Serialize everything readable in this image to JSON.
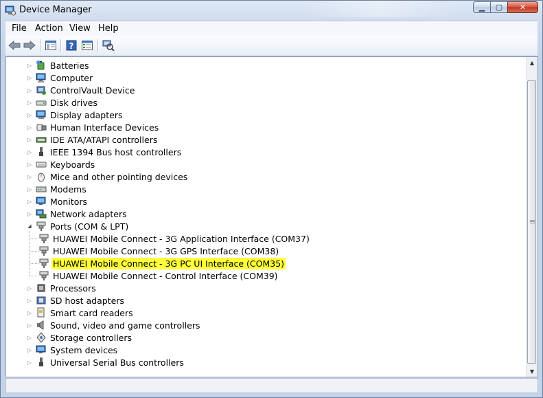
{
  "window": {
    "title": "Device Manager"
  },
  "menu": [
    "File",
    "Action",
    "View",
    "Help"
  ],
  "toolbar": {
    "buttons": [
      "back-arrow-icon",
      "forward-arrow-icon",
      "show-hide-console-tree-icon",
      "help-icon",
      "properties-icon",
      "scan-hardware-changes-icon"
    ]
  },
  "tree": {
    "categories": [
      {
        "label": "Batteries",
        "icon": "battery-icon",
        "expanded": false
      },
      {
        "label": "Computer",
        "icon": "computer-icon",
        "expanded": false
      },
      {
        "label": "ControlVault Device",
        "icon": "controlvault-icon",
        "expanded": false
      },
      {
        "label": "Disk drives",
        "icon": "disk-drive-icon",
        "expanded": false
      },
      {
        "label": "Display adapters",
        "icon": "display-adapter-icon",
        "expanded": false
      },
      {
        "label": "Human Interface Devices",
        "icon": "hid-icon",
        "expanded": false
      },
      {
        "label": "IDE ATA/ATAPI controllers",
        "icon": "ide-controller-icon",
        "expanded": false
      },
      {
        "label": "IEEE 1394 Bus host controllers",
        "icon": "ieee1394-icon",
        "expanded": false
      },
      {
        "label": "Keyboards",
        "icon": "keyboard-icon",
        "expanded": false
      },
      {
        "label": "Mice and other pointing devices",
        "icon": "mouse-icon",
        "expanded": false
      },
      {
        "label": "Modems",
        "icon": "modem-icon",
        "expanded": false
      },
      {
        "label": "Monitors",
        "icon": "monitor-icon",
        "expanded": false
      },
      {
        "label": "Network adapters",
        "icon": "network-adapter-icon",
        "expanded": false
      },
      {
        "label": "Ports (COM & LPT)",
        "icon": "port-icon",
        "expanded": true,
        "children": [
          {
            "label": "HUAWEI Mobile Connect - 3G Application Interface (COM37)",
            "icon": "port-icon",
            "highlighted": false
          },
          {
            "label": "HUAWEI Mobile Connect - 3G GPS Interface (COM38)",
            "icon": "port-icon",
            "highlighted": false
          },
          {
            "label": "HUAWEI Mobile Connect - 3G PC UI Interface (COM35)",
            "icon": "port-icon",
            "highlighted": true
          },
          {
            "label": "HUAWEI Mobile Connect - Control Interface (COM39)",
            "icon": "port-icon",
            "highlighted": false
          }
        ]
      },
      {
        "label": "Processors",
        "icon": "processor-icon",
        "expanded": false
      },
      {
        "label": "SD host adapters",
        "icon": "sd-host-icon",
        "expanded": false
      },
      {
        "label": "Smart card readers",
        "icon": "smart-card-reader-icon",
        "expanded": false
      },
      {
        "label": "Sound, video and game controllers",
        "icon": "sound-icon",
        "expanded": false
      },
      {
        "label": "Storage controllers",
        "icon": "storage-controller-icon",
        "expanded": false
      },
      {
        "label": "System devices",
        "icon": "system-devices-icon",
        "expanded": false
      },
      {
        "label": "Universal Serial Bus controllers",
        "icon": "usb-icon",
        "expanded": false
      }
    ]
  },
  "colors": {
    "highlight": "#ffff3a",
    "window_frame": "#c3d4ea"
  }
}
